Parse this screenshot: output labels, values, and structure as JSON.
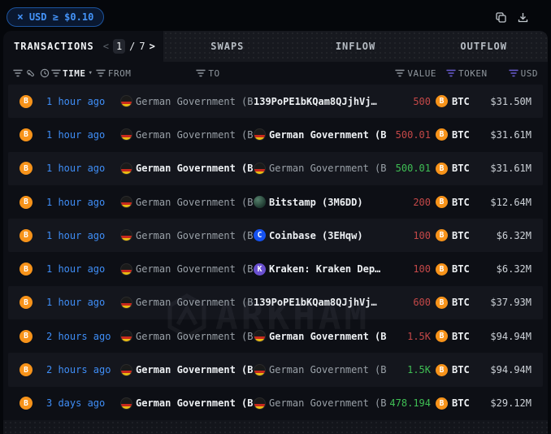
{
  "filter_chip": {
    "close_label": "×",
    "label": "USD ≥ $0.10"
  },
  "toolbar": {
    "icons": [
      "copy",
      "download"
    ]
  },
  "tab_bar": {
    "active_tab": "TRANSACTIONS",
    "pagination": {
      "prev": "<",
      "page": "1",
      "separator": "/",
      "total": "7",
      "next": ">"
    },
    "inactive_tabs": [
      "SWAPS",
      "INFLOW",
      "OUTFLOW"
    ]
  },
  "table": {
    "headers": {
      "time": "TIME",
      "from": "FROM",
      "to": "TO",
      "value": "VALUE",
      "token": "TOKEN",
      "usd": "USD"
    },
    "rows": [
      {
        "time": "1 hour ago",
        "from": {
          "name": "German Government (B",
          "icon": "german-government",
          "bold": false
        },
        "to": {
          "name": "139PoPE1bKQam8QJjhVj…",
          "icon": null,
          "bold": true
        },
        "value": {
          "text": "500",
          "direction": "out"
        },
        "token": {
          "symbol": "BTC",
          "icon": "btc"
        },
        "usd": "$31.50M"
      },
      {
        "time": "1 hour ago",
        "from": {
          "name": "German Government (B",
          "icon": "german-government",
          "bold": false
        },
        "to": {
          "name": "German Government (B",
          "icon": "german-government",
          "bold": true
        },
        "value": {
          "text": "500.01",
          "direction": "out"
        },
        "token": {
          "symbol": "BTC",
          "icon": "btc"
        },
        "usd": "$31.61M"
      },
      {
        "time": "1 hour ago",
        "from": {
          "name": "German Government (B",
          "icon": "german-government",
          "bold": true
        },
        "to": {
          "name": "German Government (B",
          "icon": "german-government",
          "bold": false
        },
        "value": {
          "text": "500.01",
          "direction": "in"
        },
        "token": {
          "symbol": "BTC",
          "icon": "btc"
        },
        "usd": "$31.61M"
      },
      {
        "time": "1 hour ago",
        "from": {
          "name": "German Government (B",
          "icon": "german-government",
          "bold": false
        },
        "to": {
          "name": "Bitstamp (3M6DD)",
          "icon": "bitstamp",
          "bold": true
        },
        "value": {
          "text": "200",
          "direction": "out"
        },
        "token": {
          "symbol": "BTC",
          "icon": "btc"
        },
        "usd": "$12.64M"
      },
      {
        "time": "1 hour ago",
        "from": {
          "name": "German Government (B",
          "icon": "german-government",
          "bold": false
        },
        "to": {
          "name": "Coinbase (3EHqw)",
          "icon": "coinbase",
          "bold": true
        },
        "value": {
          "text": "100",
          "direction": "out"
        },
        "token": {
          "symbol": "BTC",
          "icon": "btc"
        },
        "usd": "$6.32M"
      },
      {
        "time": "1 hour ago",
        "from": {
          "name": "German Government (B",
          "icon": "german-government",
          "bold": false
        },
        "to": {
          "name": "Kraken: Kraken Dep…",
          "icon": "kraken",
          "bold": true
        },
        "value": {
          "text": "100",
          "direction": "out"
        },
        "token": {
          "symbol": "BTC",
          "icon": "btc"
        },
        "usd": "$6.32M"
      },
      {
        "time": "1 hour ago",
        "from": {
          "name": "German Government (B",
          "icon": "german-government",
          "bold": false
        },
        "to": {
          "name": "139PoPE1bKQam8QJjhVj…",
          "icon": null,
          "bold": true
        },
        "value": {
          "text": "600",
          "direction": "out"
        },
        "token": {
          "symbol": "BTC",
          "icon": "btc"
        },
        "usd": "$37.93M"
      },
      {
        "time": "2 hours ago",
        "from": {
          "name": "German Government (B",
          "icon": "german-government",
          "bold": false
        },
        "to": {
          "name": "German Government (B",
          "icon": "german-government",
          "bold": true
        },
        "value": {
          "text": "1.5K",
          "direction": "out"
        },
        "token": {
          "symbol": "BTC",
          "icon": "btc"
        },
        "usd": "$94.94M"
      },
      {
        "time": "2 hours ago",
        "from": {
          "name": "German Government (B",
          "icon": "german-government",
          "bold": true
        },
        "to": {
          "name": "German Government (B",
          "icon": "german-government",
          "bold": false
        },
        "value": {
          "text": "1.5K",
          "direction": "in"
        },
        "token": {
          "symbol": "BTC",
          "icon": "btc"
        },
        "usd": "$94.94M"
      },
      {
        "time": "3 days ago",
        "from": {
          "name": "German Government (B",
          "icon": "german-government",
          "bold": true
        },
        "to": {
          "name": "German Government (B",
          "icon": "german-government",
          "bold": false
        },
        "value": {
          "text": "478.194",
          "direction": "in"
        },
        "token": {
          "symbol": "BTC",
          "icon": "btc"
        },
        "usd": "$29.12M"
      }
    ]
  },
  "watermark": {
    "text": "ARKHAM"
  },
  "colors": {
    "accent_blue": "#4493f8",
    "value_out_red": "#c44848",
    "value_in_green": "#3fbf54",
    "btc_orange": "#f7931a",
    "filter_purple": "#695cd1",
    "panel_bg": "#0d0f15",
    "row_alt_bg": "#14161d"
  }
}
